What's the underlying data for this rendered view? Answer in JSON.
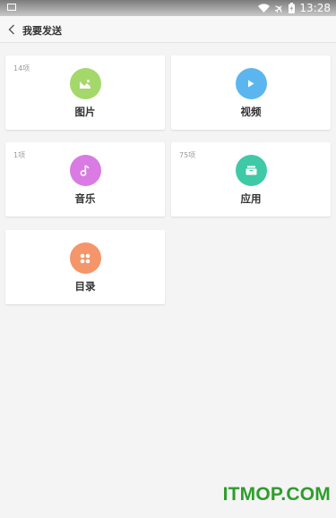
{
  "status_bar": {
    "time": "13:28"
  },
  "header": {
    "title": "我要发送"
  },
  "cards": {
    "pictures": {
      "label": "图片",
      "count": "14项",
      "color": "#a5d86a",
      "icon": "image-icon"
    },
    "videos": {
      "label": "视频",
      "count": "",
      "color": "#5bb6f0",
      "icon": "play-icon"
    },
    "music": {
      "label": "音乐",
      "count": "1项",
      "color": "#d97be2",
      "icon": "music-note-icon"
    },
    "apps": {
      "label": "应用",
      "count": "75项",
      "color": "#3fc9a6",
      "icon": "app-box-icon"
    },
    "directory": {
      "label": "目录",
      "count": "",
      "color": "#f5956a",
      "icon": "four-dots-icon"
    }
  },
  "watermark": {
    "text": "ITMOP.COM",
    "color": "#2c9e2a"
  }
}
